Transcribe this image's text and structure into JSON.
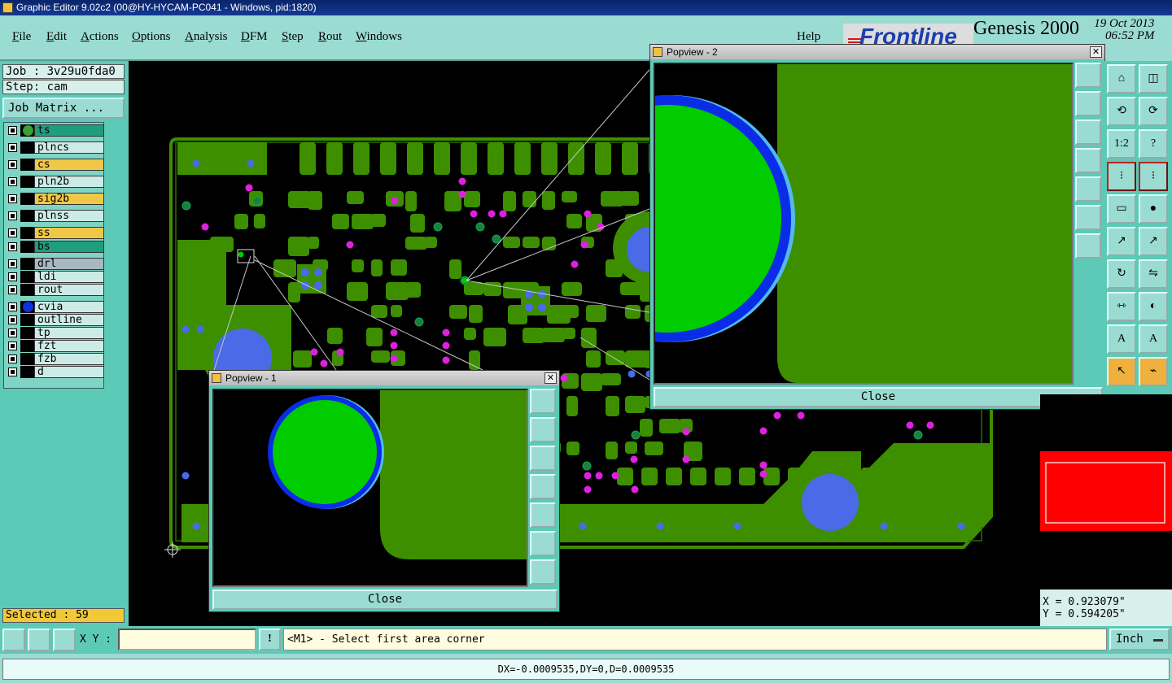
{
  "window": {
    "title": "Graphic Editor 9.02c2 (00@HY-HYCAM-PC041 - Windows, pid:1820)"
  },
  "menu": {
    "items": [
      "File",
      "Edit",
      "Actions",
      "Options",
      "Analysis",
      "DFM",
      "Step",
      "Rout",
      "Windows"
    ],
    "help": "Help"
  },
  "brand": {
    "logo": "Frontline",
    "product": "Genesis 2000",
    "date": "19 Oct 2013",
    "time": "06:52 PM"
  },
  "job": {
    "job_label": "Job : 3v29u0fda0",
    "step_label": "Step: cam",
    "matrix_button": "Job Matrix ..."
  },
  "layers": [
    {
      "name": "ts",
      "color": "#1f9e7e",
      "swatch": "#3aa030"
    },
    {
      "name": "plncs",
      "color": "#cdebe6",
      "swatch": ""
    },
    {
      "name": "cs",
      "color": "#f0c848",
      "swatch": ""
    },
    {
      "name": "pln2b",
      "color": "#cdebe6",
      "swatch": ""
    },
    {
      "name": "sig2b",
      "color": "#f0c848",
      "swatch": ""
    },
    {
      "name": "plnss",
      "color": "#cdebe6",
      "swatch": ""
    },
    {
      "name": "ss",
      "color": "#f0c848",
      "swatch": ""
    },
    {
      "name": "bs",
      "color": "#1f9e7e",
      "swatch": ""
    },
    {
      "name": "drl",
      "color": "#a8b8c0",
      "swatch": ""
    },
    {
      "name": "ldi",
      "color": "#cdebe6",
      "swatch": ""
    },
    {
      "name": "rout",
      "color": "#cdebe6",
      "swatch": ""
    },
    {
      "name": "cvia",
      "color": "#cdebe6",
      "swatch": "#1030e0"
    },
    {
      "name": "outline",
      "color": "#cdebe6",
      "swatch": ""
    },
    {
      "name": "tp",
      "color": "#cdebe6",
      "swatch": ""
    },
    {
      "name": "fzt",
      "color": "#cdebe6",
      "swatch": ""
    },
    {
      "name": "fzb",
      "color": "#cdebe6",
      "swatch": ""
    },
    {
      "name": "d",
      "color": "#cdebe6",
      "swatch": ""
    }
  ],
  "selected": "Selected : 59",
  "popview1": {
    "title": "Popview - 1",
    "close": "Close"
  },
  "popview2": {
    "title": "Popview - 2",
    "close": "Close"
  },
  "coords": {
    "x": "X = 0.923079\"",
    "y": "Y = 0.594205\""
  },
  "toolbar_right": [
    "home-icon",
    "window-icon",
    "undo-icon",
    "redo-icon",
    "scale-icon",
    "help-icon",
    "layer-left-icon",
    "layer-right-icon",
    "ruler-icon",
    "dot-icon",
    "connect-icon",
    "connect-alt-icon",
    "rotate-icon",
    "flip-icon",
    "measure-icon",
    "shapes-icon",
    "text-a-icon",
    "text-a-alt-icon",
    "pointer-icon",
    "route-icon"
  ],
  "bottom": {
    "xy_label": "X Y :",
    "xy_value": "",
    "warn": "!",
    "prompt": "<M1> - Select first area corner",
    "units": "Inch"
  },
  "status": "DX=-0.0009535,DY=0,D=0.0009535",
  "colors": {
    "board": "#3d8f00",
    "pad_green": "#00cc00",
    "via_blue": "#4a6ae8",
    "drill_magenta": "#e020e0",
    "panel": "#5ccab6",
    "menubar": "#9bdcd2"
  }
}
